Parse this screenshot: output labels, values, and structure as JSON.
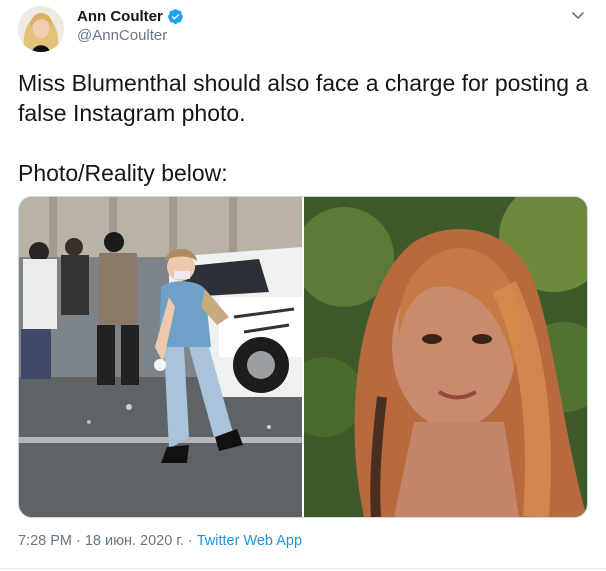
{
  "user": {
    "name": "Ann Coulter",
    "handle": "@AnnCoulter"
  },
  "tweet": {
    "text_line1": "Miss Blumenthal should also face a charge for posting a false Instagram photo.",
    "text_line2": "Photo/Reality below:"
  },
  "media": [
    {
      "icon": "protest-photo"
    },
    {
      "icon": "portrait-photo"
    }
  ],
  "meta": {
    "time": "7:28 PM",
    "sep": "·",
    "date": "18 июн. 2020 г.",
    "sep2": "·",
    "source": "Twitter Web App"
  },
  "colors": {
    "link": "#1b95e0",
    "verified": "#1da1f2",
    "secondary": "#657786"
  }
}
